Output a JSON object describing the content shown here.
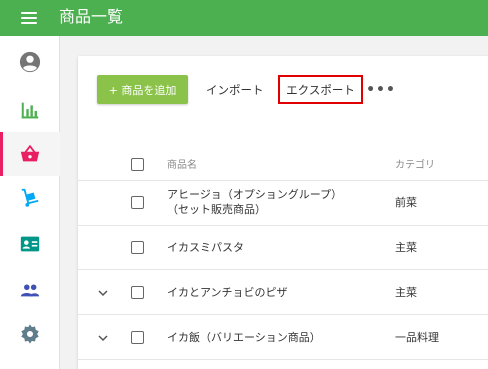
{
  "app": {
    "title": "商品一覧"
  },
  "sidebar": {
    "items": [
      {
        "name": "account",
        "icon": "account-circle-icon",
        "color": "#757575"
      },
      {
        "name": "reports",
        "icon": "bar-chart-icon",
        "color": "#4caf50"
      },
      {
        "name": "products",
        "icon": "basket-icon",
        "color": "#e91e63",
        "active": true
      },
      {
        "name": "inventory",
        "icon": "hand-truck-icon",
        "color": "#03a9f4"
      },
      {
        "name": "customers",
        "icon": "contact-card-icon",
        "color": "#009688"
      },
      {
        "name": "staff",
        "icon": "people-icon",
        "color": "#3f51b5"
      },
      {
        "name": "settings",
        "icon": "gear-icon",
        "color": "#607d8b"
      }
    ]
  },
  "toolbar": {
    "add_label": "+ 商品を追加",
    "import_label": "インポート",
    "export_label": "エクスポート",
    "more_label": "•••"
  },
  "table": {
    "headers": {
      "name": "商品名",
      "category": "カテゴリ"
    },
    "rows": [
      {
        "name_line1": "アヒージョ（オプショングループ）",
        "name_line2": "（セット販売商品）",
        "category": "前菜",
        "expandable": false
      },
      {
        "name_line1": "イカスミパスタ",
        "category": "主菜",
        "expandable": false
      },
      {
        "name_line1": "イカとアンチョビのピザ",
        "category": "主菜",
        "expandable": true
      },
      {
        "name_line1": "イカ飯（バリエーション商品）",
        "category": "一品料理",
        "expandable": true
      }
    ]
  },
  "colors": {
    "appbar": "#4caf50",
    "add_button": "#8bc34a",
    "highlight": "#e00000",
    "active_indicator": "#e91e63"
  }
}
